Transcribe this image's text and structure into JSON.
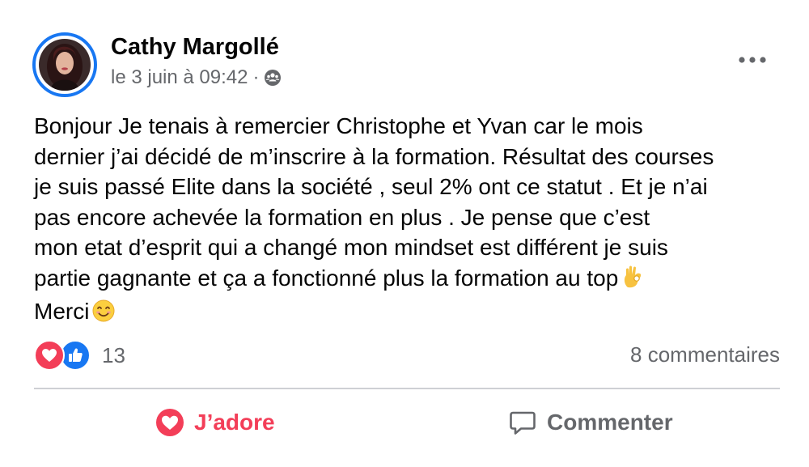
{
  "post": {
    "author": "Cathy Margollé",
    "timestamp": "le 3 juin à 09:42",
    "meta_separator": "·",
    "audience_icon": "friends-icon",
    "more_icon": "more-horizontal-icon",
    "text_lines": [
      "Bonjour Je tenais à remercier Christophe et Yvan   car le mois",
      "dernier j’ai décidé de m’inscrire à la formation. Résultat des courses",
      "je suis passé Elite dans la société , seul 2% ont ce statut . Et je n’ai",
      "pas encore achevée la formation en plus      . Je pense que c’est",
      "mon etat d’esprit qui a changé mon mindset est différent   je suis",
      "partie gagnante et ça a fonctionné plus la formation au top",
      "Merci"
    ],
    "line6_emoji": "ok-hand-emoji",
    "line7_emoji": "smiling-face-emoji"
  },
  "reactions": {
    "types": [
      "love",
      "like"
    ],
    "count": "13",
    "comments_label": "8 commentaires"
  },
  "actions": {
    "love_label": "J’adore",
    "comment_label": "Commenter"
  },
  "colors": {
    "accent_blue": "#1877f2",
    "love_red": "#f33e58",
    "secondary_text": "#65676b",
    "divider": "#ced0d4"
  }
}
